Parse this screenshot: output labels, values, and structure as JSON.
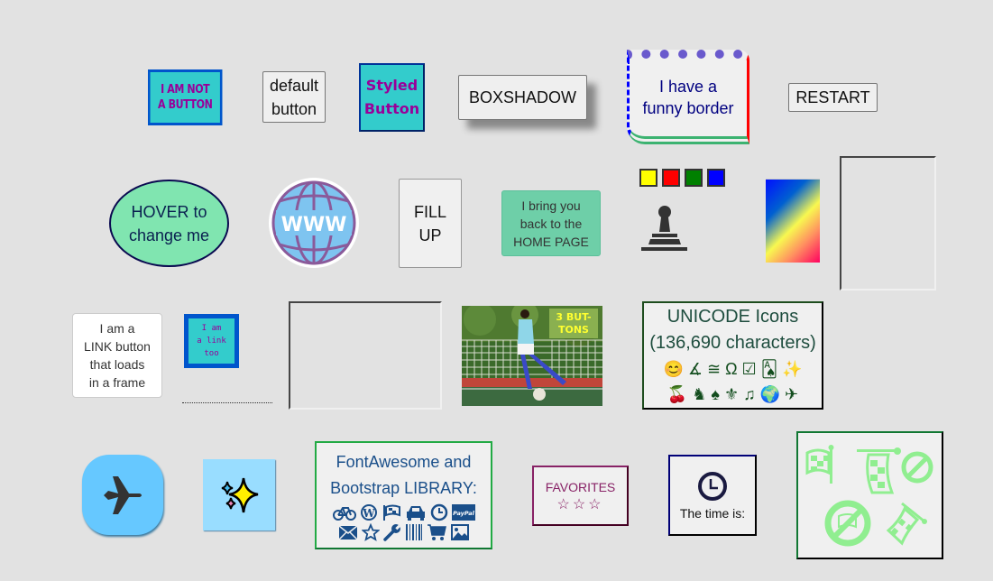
{
  "row1": {
    "not_button": {
      "line1": "I AM NOT",
      "line2": "A BUTTON"
    },
    "default_button": {
      "line1": "default",
      "line2": "button"
    },
    "styled_button": {
      "line1": "Styled",
      "line2": "Button"
    },
    "boxshadow_button": "BOXSHADOW",
    "funny_border": {
      "line1": "I have a",
      "line2": "funny border"
    },
    "restart_button": "RESTART"
  },
  "row2": {
    "hover_button": {
      "line1": "HOVER to",
      "line2": "change me"
    },
    "www_icon_label": "WWW",
    "fill_up_button": {
      "line1": "FILL",
      "line2": "UP"
    },
    "home_page_button": {
      "line1": "I bring you",
      "line2": "back to the",
      "line3": "HOME PAGE"
    },
    "color_swatches": [
      {
        "name": "yellow",
        "color": "#ffff00"
      },
      {
        "name": "red",
        "color": "#ff0000"
      },
      {
        "name": "green",
        "color": "#008000"
      },
      {
        "name": "blue",
        "color": "#0000ff"
      }
    ]
  },
  "row3": {
    "link_button": {
      "line1": "I am a",
      "line2": "LINK button",
      "line3": "that loads",
      "line4": "in a frame"
    },
    "link_too": {
      "line1": "I am",
      "line2": "a link",
      "line3": "too"
    },
    "photo_badge": {
      "line1": "3 BUT-",
      "line2": "TONS"
    },
    "unicode_box": {
      "title1": "UNICODE Icons",
      "title2": "(136,690 characters)",
      "icons_row1": "😊 ∡ ≅ Ω ☑ 🂡 ✨",
      "icons_row2": "🍒 ♞ ♠ ⚜ ♫ 🌍 ✈"
    }
  },
  "row4": {
    "fa_box": {
      "title1": "FontAwesome and",
      "title2": "Bootstrap LIBRARY:",
      "paypal_label": "PayPal"
    },
    "favorites": {
      "label": "FAVORITES",
      "stars": "☆☆☆"
    },
    "time_box": {
      "label": "The time is:"
    }
  }
}
